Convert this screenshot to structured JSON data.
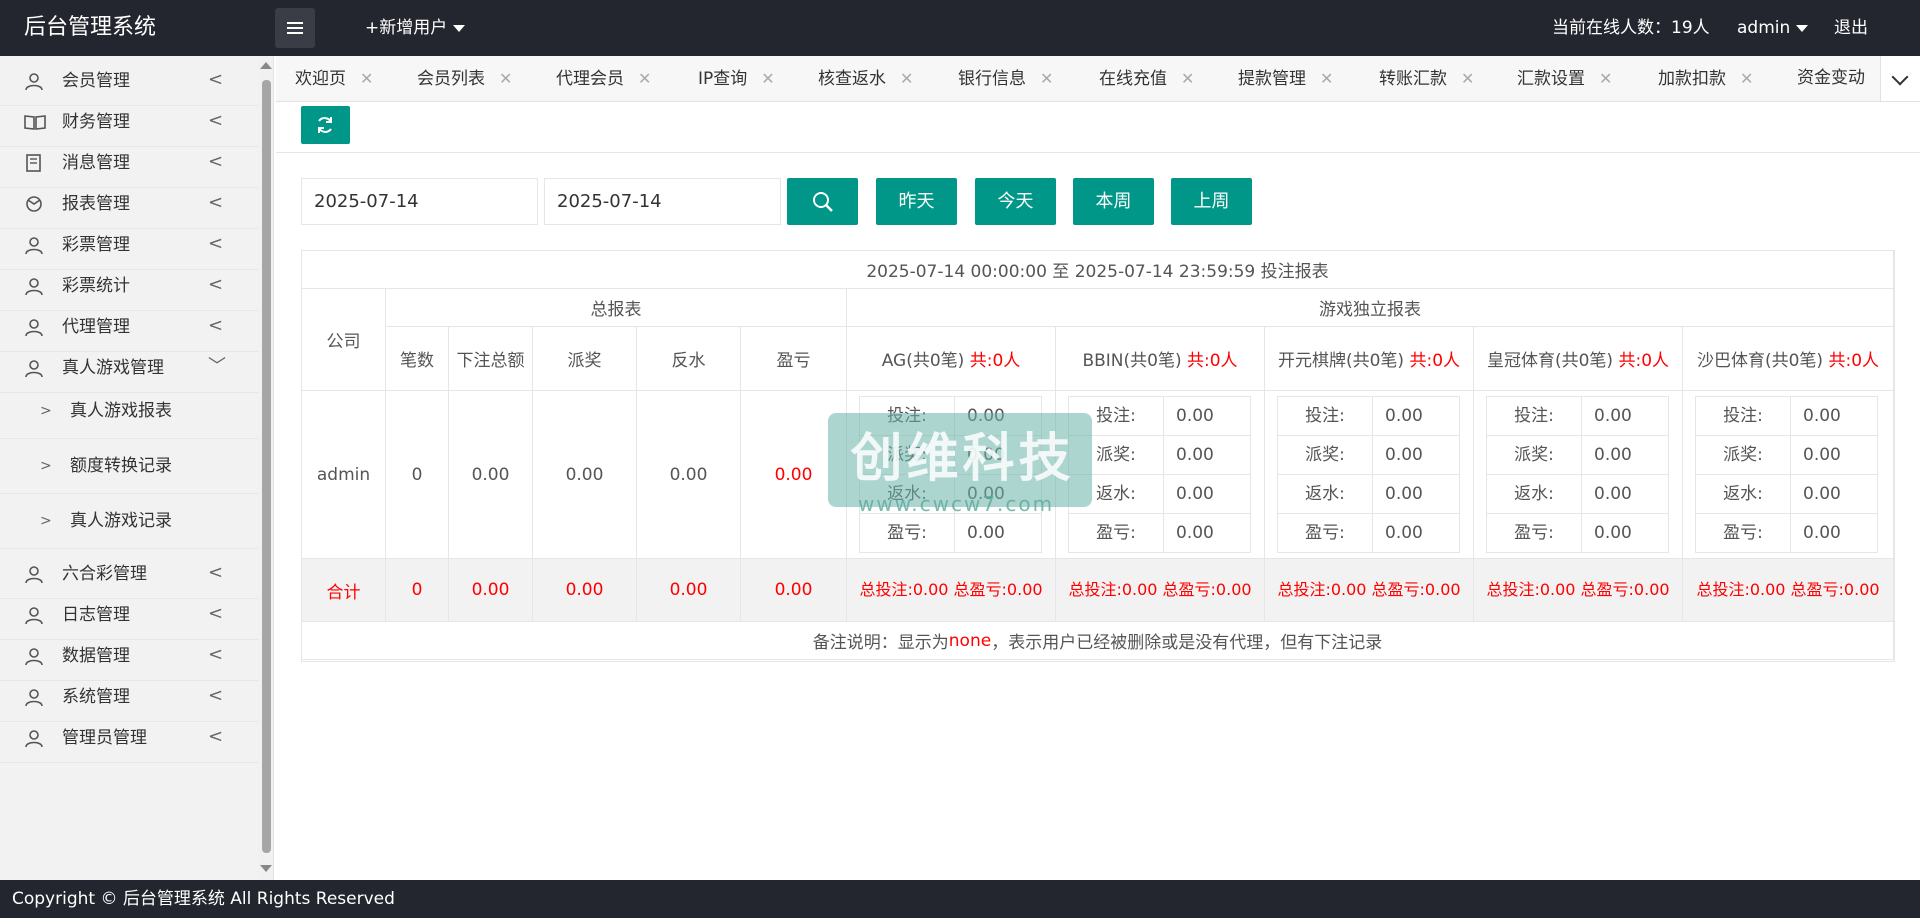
{
  "header": {
    "logo": "后台管理系统",
    "add_user": "+新增用户",
    "online_users": "当前在线人数：19人",
    "admin": "admin",
    "logout": "退出"
  },
  "sidebar": {
    "items": [
      {
        "label": "会员管理",
        "icon": "user-icon"
      },
      {
        "label": "财务管理",
        "icon": "book-icon"
      },
      {
        "label": "消息管理",
        "icon": "message-icon"
      },
      {
        "label": "报表管理",
        "icon": "report-icon"
      },
      {
        "label": "彩票管理",
        "icon": "user-icon"
      },
      {
        "label": "彩票统计",
        "icon": "user-icon"
      },
      {
        "label": "代理管理",
        "icon": "user-icon"
      },
      {
        "label": "真人游戏管理",
        "icon": "user-icon"
      }
    ],
    "sub_items": [
      {
        "label": "真人游戏报表"
      },
      {
        "label": "额度转换记录"
      },
      {
        "label": "真人游戏记录"
      }
    ],
    "items_after": [
      {
        "label": "六合彩管理",
        "icon": "user-icon"
      },
      {
        "label": "日志管理",
        "icon": "user-icon"
      },
      {
        "label": "数据管理",
        "icon": "user-icon"
      },
      {
        "label": "系统管理",
        "icon": "user-icon"
      },
      {
        "label": "管理员管理",
        "icon": "user-icon"
      }
    ]
  },
  "tabs": [
    "欢迎页",
    "会员列表",
    "代理会员",
    "IP查询",
    "核查返水",
    "银行信息",
    "在线充值",
    "提款管理",
    "转账汇款",
    "汇款设置",
    "加款扣款",
    "资金变动"
  ],
  "filter": {
    "start_date": "2025-07-14",
    "end_date": "2025-07-14",
    "yesterday": "昨天",
    "today": "今天",
    "this_week": "本周",
    "last_week": "上周"
  },
  "report": {
    "title": "2025-07-14 00:00:00 至 2025-07-14 23:59:59 投注报表",
    "company_header": "公司",
    "total_header": "总报表",
    "game_header": "游戏独立报表",
    "total_cols": [
      "笔数",
      "下注总额",
      "派奖",
      "反水",
      "盈亏"
    ],
    "games": [
      {
        "name": "AG(共0笔)",
        "users": "共:0人"
      },
      {
        "name": "BBIN(共0笔)",
        "users": "共:0人"
      },
      {
        "name": "开元棋牌(共0笔)",
        "users": "共:0人"
      },
      {
        "name": "皇冠体育(共0笔)",
        "users": "共:0人"
      },
      {
        "name": "沙巴体育(共0笔)",
        "users": "共:0人"
      }
    ],
    "detail_keys": [
      "投注:",
      "派奖:",
      "返水:",
      "盈亏:"
    ],
    "row": {
      "company": "admin",
      "values": [
        "0",
        "0.00",
        "0.00",
        "0.00",
        "0.00"
      ],
      "game_values": [
        [
          "0.00",
          "0.00",
          "0.00",
          "0.00"
        ],
        [
          "0.00",
          "0.00",
          "0.00",
          "0.00"
        ],
        [
          "0.00",
          "0.00",
          "0.00",
          "0.00"
        ],
        [
          "0.00",
          "0.00",
          "0.00",
          "0.00"
        ],
        [
          "0.00",
          "0.00",
          "0.00",
          "0.00"
        ]
      ]
    },
    "totals": {
      "label": "合计",
      "values": [
        "0",
        "0.00",
        "0.00",
        "0.00",
        "0.00"
      ],
      "game_summary": [
        "总投注:0.00 总盈亏:0.00",
        "总投注:0.00 总盈亏:0.00",
        "总投注:0.00 总盈亏:0.00",
        "总投注:0.00 总盈亏:0.00",
        "总投注:0.00 总盈亏:0.00"
      ]
    },
    "note_prefix": "备注说明：显示为",
    "note_highlight": "none",
    "note_suffix": "，表示用户已经被删除或是没有代理，但有下注记录"
  },
  "watermark": {
    "text": "创维科技",
    "url": "www.cwcw7.com"
  },
  "footer": "Copyright © 后台管理系统 All Rights Reserved",
  "colors": {
    "accent": "#009688",
    "header_bg": "#23262e",
    "warning_red": "#ff0000"
  }
}
